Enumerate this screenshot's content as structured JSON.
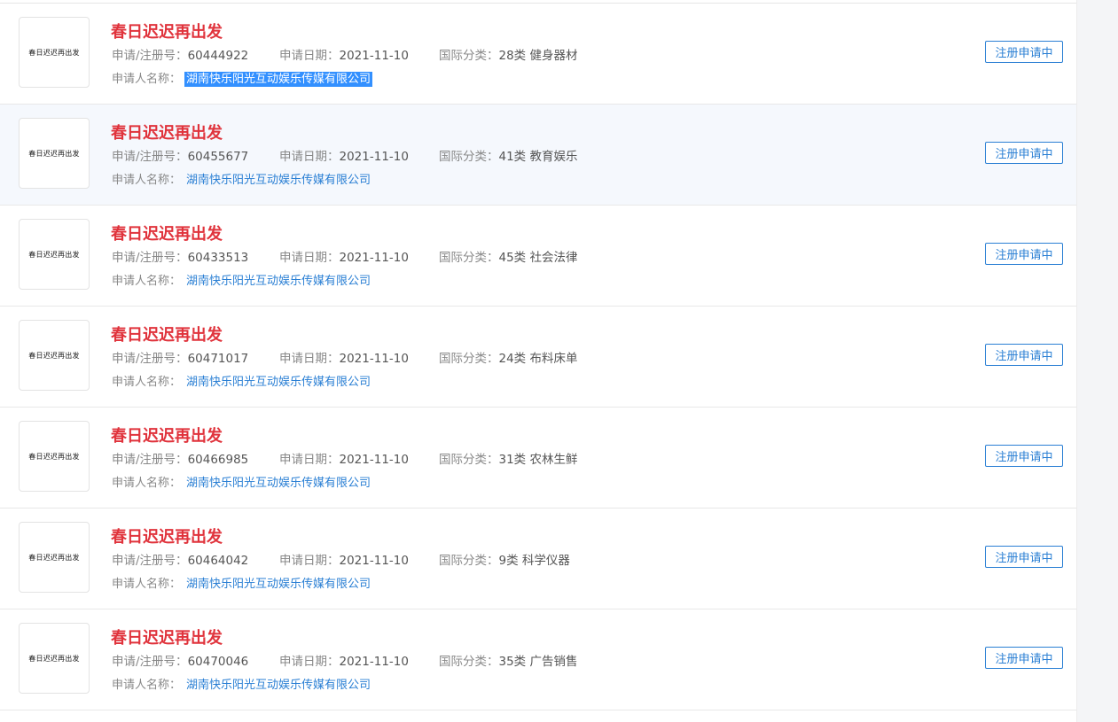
{
  "labels": {
    "reg_no": "申请/注册号：",
    "date": "申请日期：",
    "class": "国际分类：",
    "applicant": "申请人名称："
  },
  "rows": [
    {
      "thumb": "春日迟迟再出发",
      "name": "春日迟迟再出发",
      "reg_no": "60444922",
      "date": "2021-11-10",
      "class": "28类 健身器材",
      "applicant": "湖南快乐阳光互动娱乐传媒有限公司",
      "status": "注册申请中"
    },
    {
      "thumb": "春日迟迟再出发",
      "name": "春日迟迟再出发",
      "reg_no": "60455677",
      "date": "2021-11-10",
      "class": "41类 教育娱乐",
      "applicant": "湖南快乐阳光互动娱乐传媒有限公司",
      "status": "注册申请中"
    },
    {
      "thumb": "春日迟迟再出发",
      "name": "春日迟迟再出发",
      "reg_no": "60433513",
      "date": "2021-11-10",
      "class": "45类 社会法律",
      "applicant": "湖南快乐阳光互动娱乐传媒有限公司",
      "status": "注册申请中"
    },
    {
      "thumb": "春日迟迟再出发",
      "name": "春日迟迟再出发",
      "reg_no": "60471017",
      "date": "2021-11-10",
      "class": "24类 布料床单",
      "applicant": "湖南快乐阳光互动娱乐传媒有限公司",
      "status": "注册申请中"
    },
    {
      "thumb": "春日迟迟再出发",
      "name": "春日迟迟再出发",
      "reg_no": "60466985",
      "date": "2021-11-10",
      "class": "31类 农林生鲜",
      "applicant": "湖南快乐阳光互动娱乐传媒有限公司",
      "status": "注册申请中"
    },
    {
      "thumb": "春日迟迟再出发",
      "name": "春日迟迟再出发",
      "reg_no": "60464042",
      "date": "2021-11-10",
      "class": "9类 科学仪器",
      "applicant": "湖南快乐阳光互动娱乐传媒有限公司",
      "status": "注册申请中"
    },
    {
      "thumb": "春日迟迟再出发",
      "name": "春日迟迟再出发",
      "reg_no": "60470046",
      "date": "2021-11-10",
      "class": "35类 广告销售",
      "applicant": "湖南快乐阳光互动娱乐传媒有限公司",
      "status": "注册申请中"
    }
  ],
  "colors": {
    "trademark_name": "#e0333c",
    "link": "#2a7fd4",
    "selection": "#3390ff",
    "hover_row": "#f5f8fd"
  }
}
